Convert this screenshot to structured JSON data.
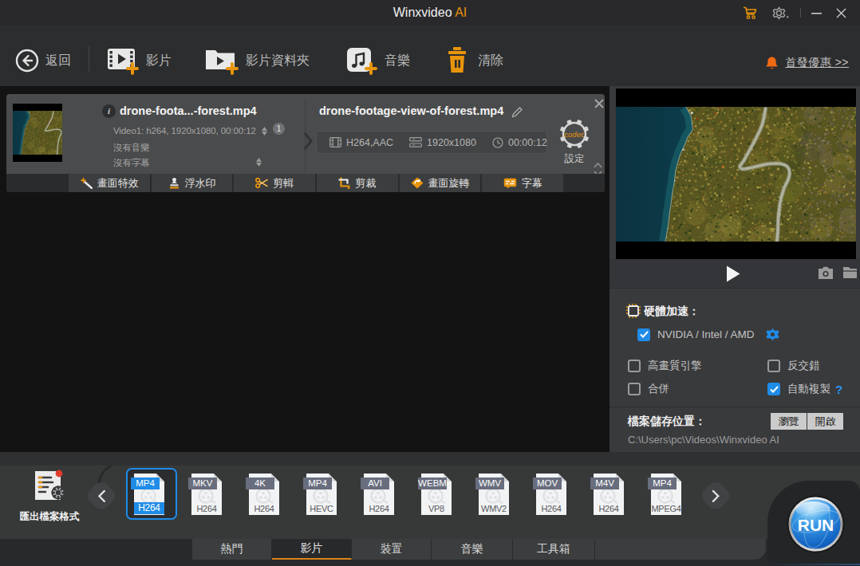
{
  "titlebar": {
    "title_main": "Winxvideo",
    "title_accent": "AI"
  },
  "toolbar": {
    "back": "返回",
    "add_video": "影片",
    "add_video_folder": "影片資料夾",
    "add_music": "音樂",
    "clear": "清除",
    "promo": "首發優惠 >>"
  },
  "file_card": {
    "source": {
      "name": "drone-foota...-forest.mp4",
      "meta": "Video1: h264, 1920x1080, 00:00:12",
      "track_count": "1",
      "no_audio": "沒有音樂",
      "no_subtitle": "沒有字幕"
    },
    "output": {
      "name": "drone-footage-view-of-forest.mp4",
      "codec": "H264,AAC",
      "resolution": "1920x1080",
      "duration": "00:00:12",
      "gear_text": "codec",
      "settings_label": "設定"
    },
    "tools": [
      {
        "label": "畫面特效",
        "icon": "effects-icon"
      },
      {
        "label": "浮水印",
        "icon": "watermark-icon"
      },
      {
        "label": "剪輯",
        "icon": "trim-icon"
      },
      {
        "label": "剪裁",
        "icon": "crop-icon"
      },
      {
        "label": "畫面旋轉",
        "icon": "rotate-icon"
      },
      {
        "label": "字幕",
        "icon": "subtitle-icon"
      }
    ]
  },
  "settings": {
    "hw_title": "硬體加速：",
    "gpu_label": "NVIDIA / Intel / AMD",
    "gpu_checked": true,
    "options": [
      {
        "label": "高畫質引擎",
        "checked": false
      },
      {
        "label": "反交錯",
        "checked": false
      },
      {
        "label": "合併",
        "checked": false
      },
      {
        "label": "自動複製",
        "checked": true,
        "help": "?"
      }
    ],
    "save_title": "檔案儲存位置：",
    "browse_label": "瀏覽",
    "open_label": "開啟",
    "save_path": "C:\\Users\\pc\\Videos\\Winxvideo AI"
  },
  "formats": {
    "title": "匯出檔案格式",
    "items": [
      {
        "container": "MP4",
        "codec": "H264",
        "selected": true
      },
      {
        "container": "MKV",
        "codec": "H264",
        "selected": false
      },
      {
        "container": "4K",
        "codec": "H264",
        "selected": false
      },
      {
        "container": "MP4",
        "codec": "HEVC",
        "selected": false
      },
      {
        "container": "AVI",
        "codec": "H264",
        "selected": false
      },
      {
        "container": "WEBM",
        "codec": "VP8",
        "selected": false
      },
      {
        "container": "WMV",
        "codec": "WMV2",
        "selected": false
      },
      {
        "container": "MOV",
        "codec": "H264",
        "selected": false
      },
      {
        "container": "M4V",
        "codec": "H264",
        "selected": false
      },
      {
        "container": "MP4",
        "codec": "MPEG4",
        "selected": false
      }
    ]
  },
  "tabs": [
    {
      "label": "熱門",
      "active": false
    },
    {
      "label": "影片",
      "active": true
    },
    {
      "label": "裝置",
      "active": false
    },
    {
      "label": "音樂",
      "active": false
    },
    {
      "label": "工具箱",
      "active": false
    }
  ],
  "run_label": "RUN",
  "colors": {
    "accent_orange": "#e8920e",
    "accent_blue": "#1f8ce8"
  }
}
